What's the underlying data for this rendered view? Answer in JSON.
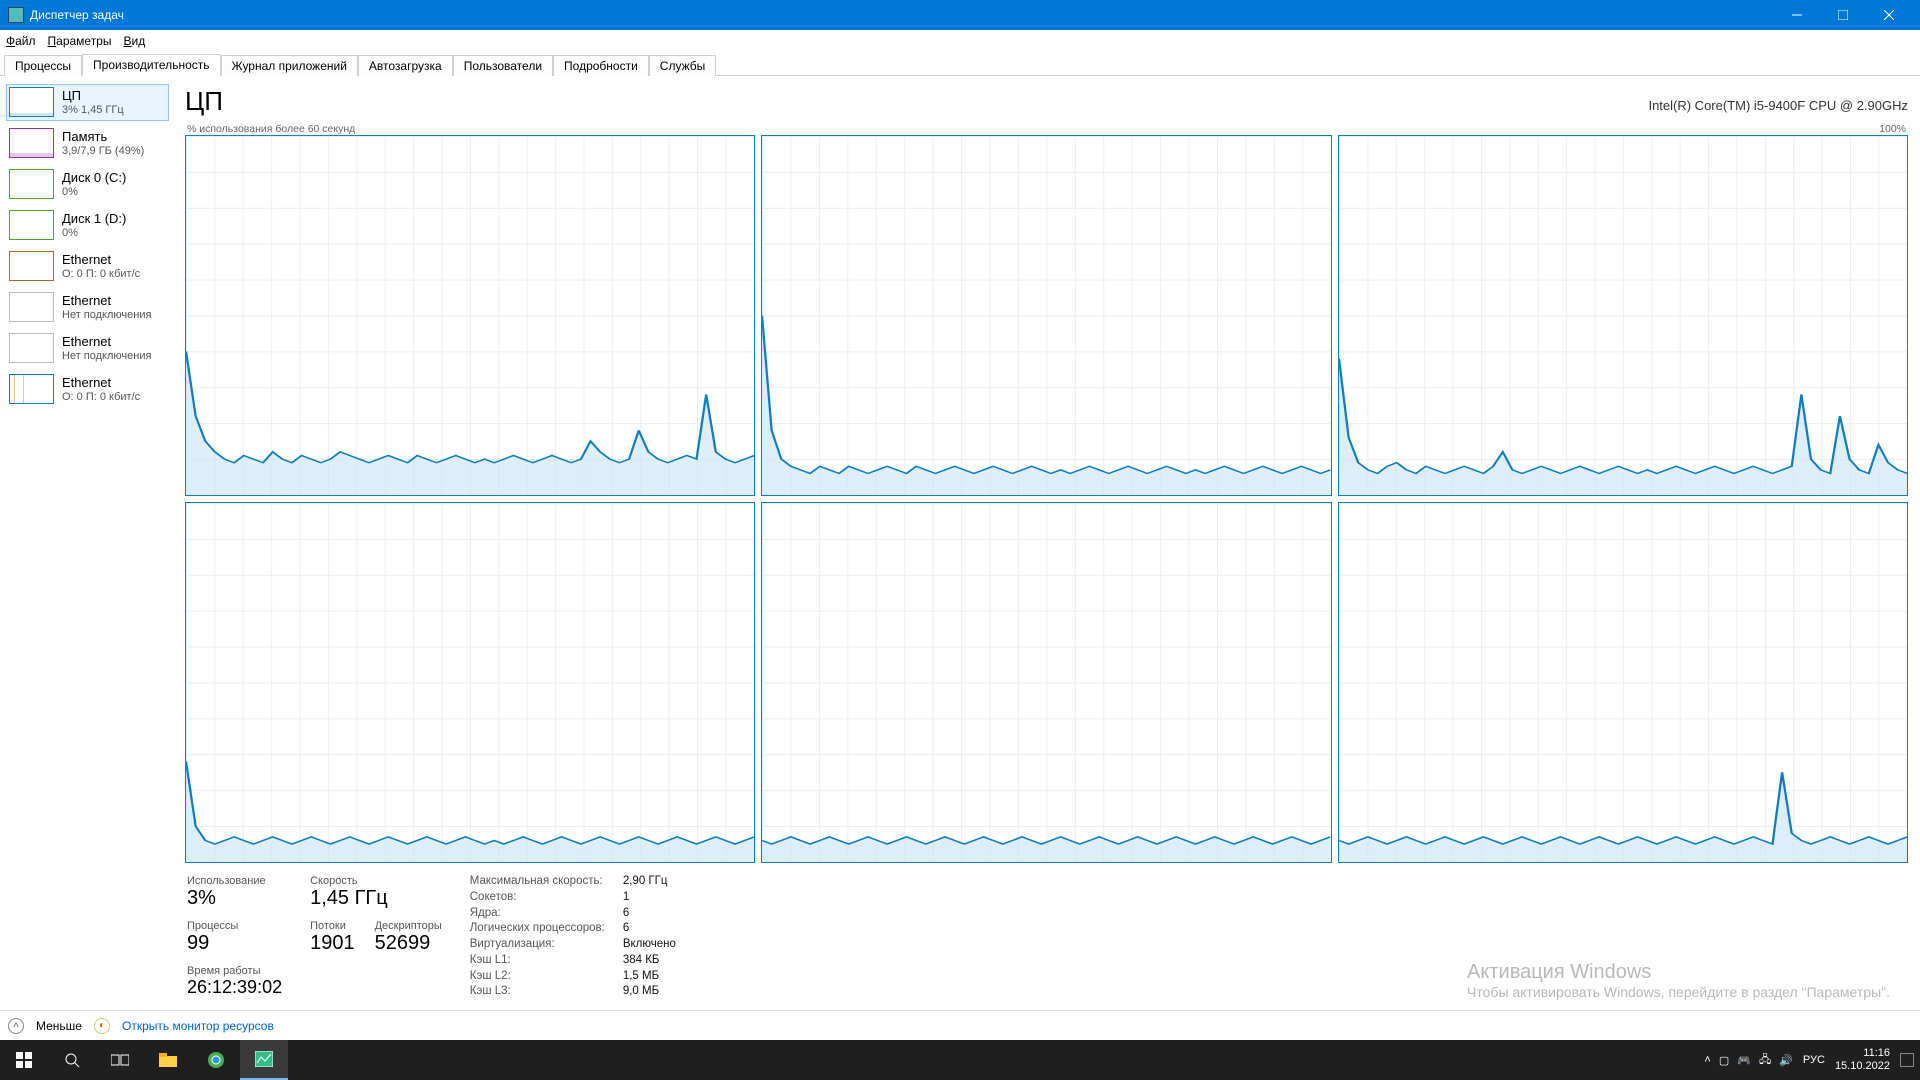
{
  "title": "Диспетчер задач",
  "menu": [
    "Файл",
    "Параметры",
    "Вид"
  ],
  "tabs": [
    "Процессы",
    "Производительность",
    "Журнал приложений",
    "Автозагрузка",
    "Пользователи",
    "Подробности",
    "Службы"
  ],
  "activeTab": 1,
  "sidebar": [
    {
      "title": "ЦП",
      "sub": "3% 1,45 ГГц",
      "kind": "cpu",
      "selected": true
    },
    {
      "title": "Память",
      "sub": "3,9/7,9 ГБ (49%)",
      "kind": "mem"
    },
    {
      "title": "Диск 0 (C:)",
      "sub": "0%",
      "kind": "disk"
    },
    {
      "title": "Диск 1 (D:)",
      "sub": "0%",
      "kind": "disk"
    },
    {
      "title": "Ethernet",
      "sub": "О: 0 П: 0 кбит/с",
      "kind": "eth"
    },
    {
      "title": "Ethernet",
      "sub": "Нет подключения",
      "kind": "eth2"
    },
    {
      "title": "Ethernet",
      "sub": "Нет подключения",
      "kind": "eth2"
    },
    {
      "title": "Ethernet",
      "sub": "О: 0 П: 0 кбит/с",
      "kind": "eth-act"
    }
  ],
  "main": {
    "title": "ЦП",
    "device": "Intel(R) Core(TM) i5-9400F CPU @ 2.90GHz",
    "chartLabelLeft": "% использования более 60 секунд",
    "chartLabelRight": "100%"
  },
  "chart_data": {
    "type": "line",
    "ylim": [
      0,
      100
    ],
    "x_seconds": 60,
    "unit": "%",
    "notes": "6 logical-processor panels; approximate per-second utilization read from gridlines",
    "series": [
      {
        "name": "LP0",
        "values": [
          40,
          22,
          15,
          12,
          10,
          9,
          11,
          10,
          9,
          12,
          10,
          9,
          11,
          10,
          9,
          10,
          12,
          11,
          10,
          9,
          10,
          11,
          10,
          9,
          11,
          10,
          9,
          10,
          11,
          10,
          9,
          10,
          9,
          10,
          11,
          10,
          9,
          10,
          11,
          10,
          9,
          10,
          15,
          12,
          10,
          9,
          10,
          18,
          12,
          10,
          9,
          10,
          11,
          10,
          28,
          12,
          10,
          9,
          10,
          11
        ]
      },
      {
        "name": "LP1",
        "values": [
          50,
          18,
          10,
          8,
          7,
          6,
          8,
          7,
          6,
          8,
          7,
          6,
          7,
          8,
          7,
          6,
          8,
          7,
          6,
          7,
          8,
          7,
          6,
          7,
          8,
          7,
          6,
          7,
          8,
          7,
          6,
          7,
          6,
          7,
          8,
          7,
          6,
          7,
          8,
          7,
          6,
          7,
          8,
          7,
          6,
          7,
          6,
          7,
          8,
          7,
          6,
          7,
          8,
          7,
          6,
          7,
          8,
          7,
          6,
          7
        ]
      },
      {
        "name": "LP2",
        "values": [
          38,
          16,
          9,
          7,
          6,
          8,
          9,
          7,
          6,
          8,
          7,
          6,
          7,
          8,
          7,
          6,
          8,
          12,
          7,
          6,
          7,
          8,
          7,
          6,
          7,
          8,
          7,
          6,
          7,
          8,
          7,
          6,
          7,
          6,
          7,
          8,
          7,
          6,
          7,
          8,
          7,
          6,
          7,
          8,
          7,
          6,
          7,
          8,
          28,
          10,
          7,
          6,
          22,
          10,
          7,
          6,
          14,
          9,
          7,
          6
        ]
      },
      {
        "name": "LP3",
        "values": [
          28,
          10,
          6,
          5,
          6,
          7,
          6,
          5,
          6,
          7,
          6,
          5,
          6,
          7,
          6,
          5,
          6,
          7,
          6,
          5,
          6,
          7,
          6,
          5,
          6,
          7,
          6,
          5,
          6,
          7,
          6,
          5,
          6,
          5,
          6,
          7,
          6,
          5,
          6,
          7,
          6,
          5,
          6,
          7,
          6,
          5,
          6,
          7,
          6,
          5,
          6,
          7,
          6,
          5,
          6,
          7,
          6,
          5,
          6,
          7
        ]
      },
      {
        "name": "LP4",
        "values": [
          6,
          5,
          6,
          7,
          6,
          5,
          6,
          7,
          6,
          5,
          6,
          7,
          6,
          5,
          6,
          7,
          6,
          5,
          6,
          7,
          6,
          5,
          6,
          7,
          6,
          5,
          6,
          7,
          6,
          5,
          6,
          7,
          6,
          5,
          6,
          7,
          6,
          5,
          6,
          7,
          6,
          5,
          6,
          7,
          6,
          5,
          6,
          7,
          6,
          5,
          6,
          7,
          6,
          5,
          6,
          7,
          6,
          5,
          6,
          7
        ]
      },
      {
        "name": "LP5",
        "values": [
          6,
          5,
          6,
          7,
          6,
          5,
          6,
          7,
          6,
          5,
          6,
          7,
          6,
          5,
          6,
          7,
          6,
          5,
          6,
          7,
          6,
          5,
          6,
          7,
          6,
          5,
          6,
          7,
          6,
          5,
          6,
          7,
          6,
          5,
          6,
          7,
          6,
          5,
          6,
          7,
          6,
          5,
          6,
          7,
          6,
          5,
          25,
          8,
          6,
          5,
          6,
          7,
          6,
          5,
          6,
          7,
          6,
          5,
          6,
          7
        ]
      }
    ]
  },
  "stats": {
    "usage_label": "Использование",
    "usage": "3%",
    "speed_label": "Скорость",
    "speed": "1,45 ГГц",
    "proc_label": "Процессы",
    "proc": "99",
    "threads_label": "Потоки",
    "threads": "1901",
    "handles_label": "Дескрипторы",
    "handles": "52699",
    "uptime_label": "Время работы",
    "uptime": "26:12:39:02"
  },
  "kv": [
    {
      "k": "Максимальная скорость:",
      "v": "2,90 ГГц"
    },
    {
      "k": "Сокетов:",
      "v": "1"
    },
    {
      "k": "Ядра:",
      "v": "6"
    },
    {
      "k": "Логических процессоров:",
      "v": "6"
    },
    {
      "k": "Виртуализация:",
      "v": "Включено"
    },
    {
      "k": "Кэш L1:",
      "v": "384 КБ"
    },
    {
      "k": "Кэш L2:",
      "v": "1,5 МБ"
    },
    {
      "k": "Кэш L3:",
      "v": "9,0 МБ"
    }
  ],
  "watermark": {
    "h": "Активация Windows",
    "s": "Чтобы активировать Windows, перейдите в раздел \"Параметры\"."
  },
  "footer": {
    "fewer": "Меньше",
    "resmon": "Открыть монитор ресурсов"
  },
  "tray": {
    "lang": "РУС",
    "time": "11:16",
    "date": "15.10.2022"
  }
}
